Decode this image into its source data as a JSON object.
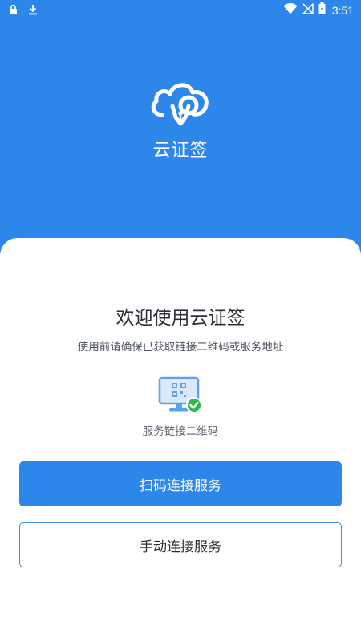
{
  "status_bar": {
    "time": "3:51",
    "icons": [
      "lock-icon",
      "download-icon",
      "wifi-icon",
      "no-signal-icon",
      "battery-icon"
    ]
  },
  "header": {
    "app_name": "云证签",
    "logo_icon": "cloud-pen-logo"
  },
  "main": {
    "title": "欢迎使用云证签",
    "subtitle": "使用前请确保已获取链接二维码或服务地址",
    "illustration_icon": "monitor-qr-check-icon",
    "illustration_caption": "服务链接二维码",
    "scan_button_label": "扫码连接服务",
    "manual_button_label": "手动连接服务"
  },
  "colors": {
    "primary": "#2d86ea",
    "check_green": "#2cb84b",
    "text_dark": "#2b2f38",
    "text_muted": "#5b6170"
  }
}
